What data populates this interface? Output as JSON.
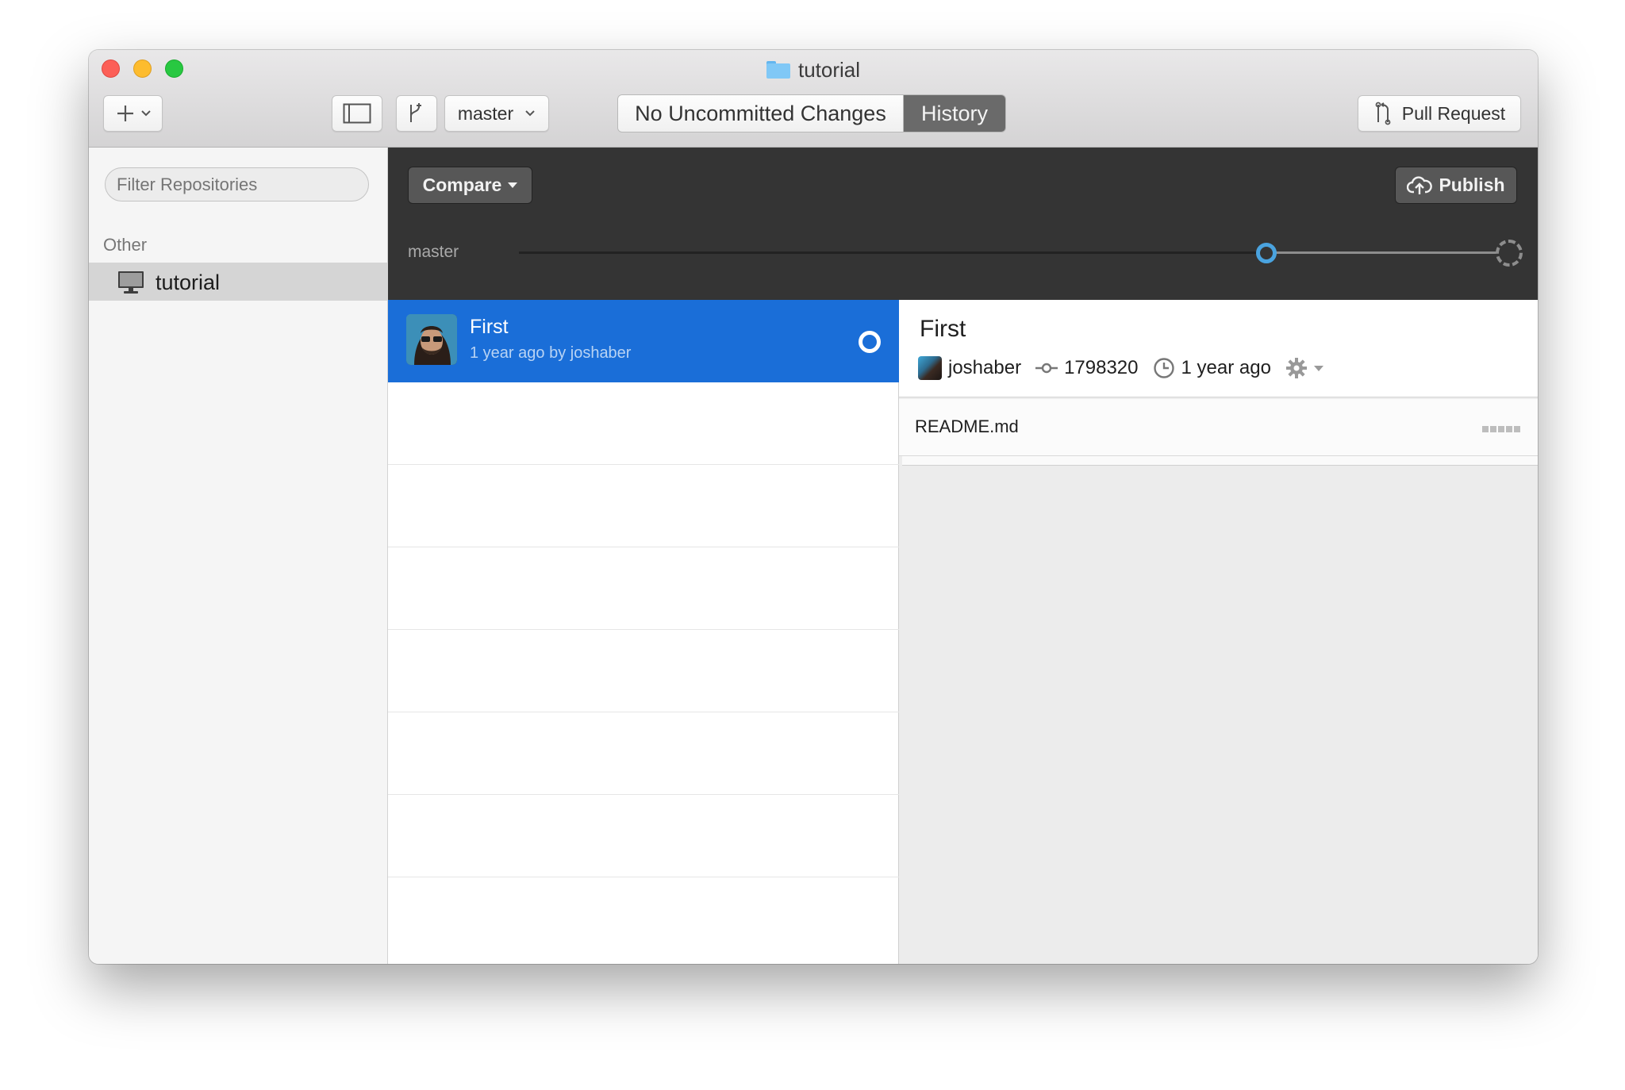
{
  "window": {
    "title": "tutorial",
    "title_icon": "folder-icon"
  },
  "toolbar": {
    "add_icon": "plus-icon",
    "sidebar_toggle_icon": "sidebar-icon",
    "new_branch_icon": "branch-icon",
    "branch_name": "master",
    "segment_changes": "No Uncommitted Changes",
    "segment_history": "History",
    "pull_request_label": "Pull Request"
  },
  "sidebar": {
    "filter_placeholder": "Filter Repositories",
    "section": "Other",
    "items": [
      {
        "label": "tutorial",
        "icon": "monitor-icon",
        "selected": true
      }
    ]
  },
  "darkbar": {
    "compare_label": "Compare",
    "publish_label": "Publish",
    "branch_label": "master"
  },
  "commits": [
    {
      "title": "First",
      "subtitle": "1 year ago by joshaber",
      "selected": true
    }
  ],
  "detail": {
    "title": "First",
    "author": "joshaber",
    "sha": "1798320",
    "time": "1 year ago",
    "files": [
      {
        "name": "README.md"
      }
    ]
  },
  "colors": {
    "selection": "#1a6ed8",
    "dark_bar": "#343434",
    "timeline_accent": "#4aa3df"
  }
}
